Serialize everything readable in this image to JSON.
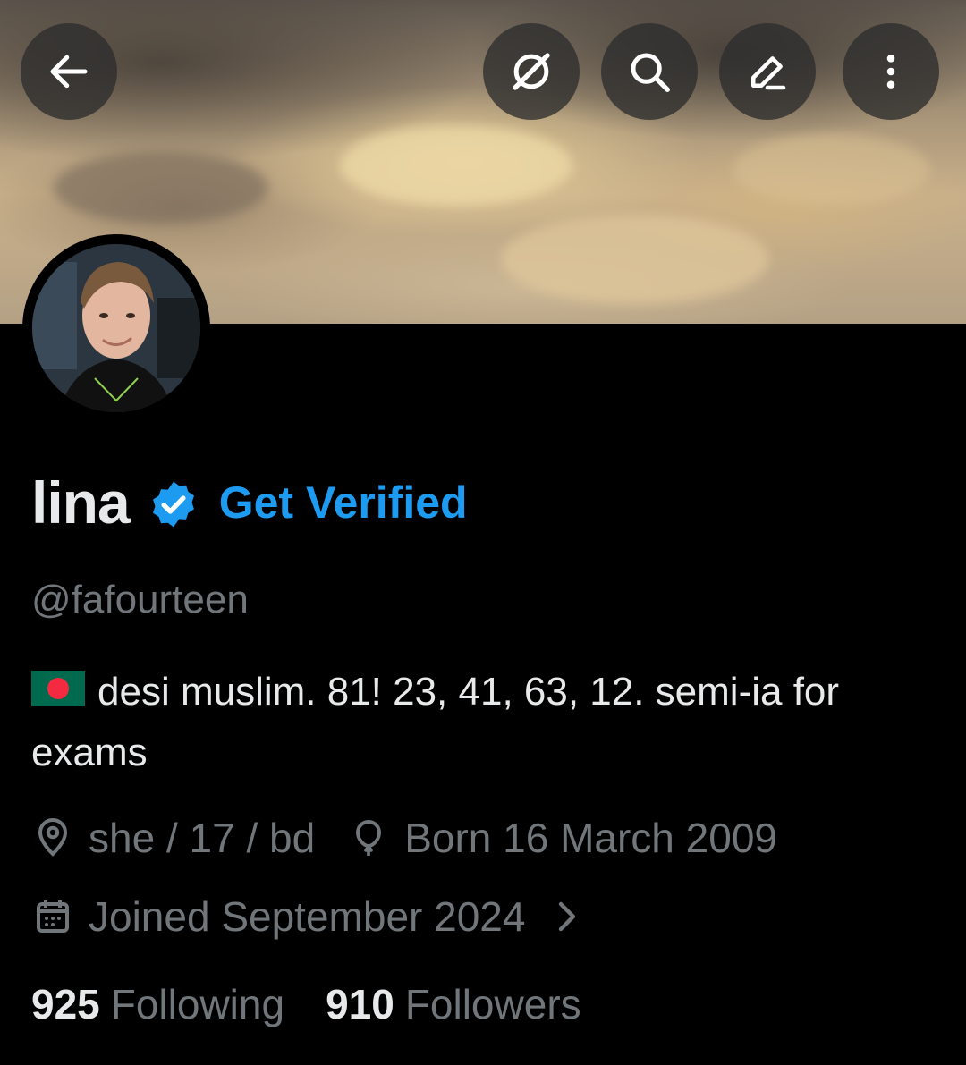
{
  "header": {
    "back_icon": "arrow-left-icon",
    "grok_icon": "grok-icon",
    "search_icon": "search-icon",
    "edit_icon": "edit-pencil-icon",
    "more_icon": "more-vertical-icon"
  },
  "profile": {
    "name": "lina",
    "verified_badge": "verified-badge-icon",
    "get_verified_label": "Get Verified",
    "handle": "@fafourteen",
    "bio_text": "desi muslim. 81! 23, 41, 63, 12. semi-ia for exams",
    "bio_flag": "bangladesh-flag",
    "location": "she / 17 / bd",
    "birthday": "Born 16 March 2009",
    "joined": "Joined September 2024",
    "following_count": "925",
    "following_label": "Following",
    "followers_count": "910",
    "followers_label": "Followers"
  },
  "colors": {
    "accent": "#1d9bf0",
    "muted": "#71767b",
    "text": "#e7e9ea",
    "background": "#000000"
  }
}
